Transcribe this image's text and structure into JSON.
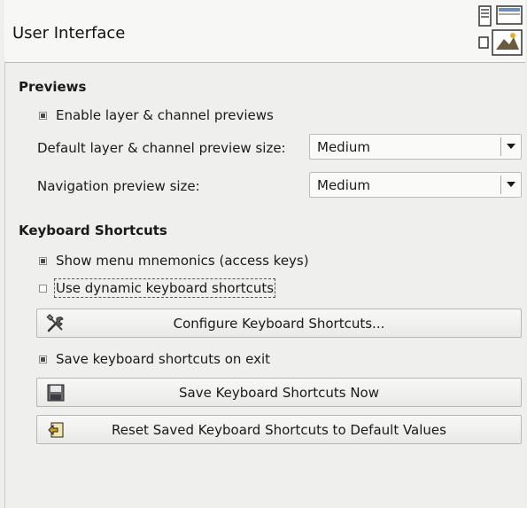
{
  "header": {
    "title": "User Interface",
    "icon": "preferences-window-icon"
  },
  "previews": {
    "section_title": "Previews",
    "enable_layer_previews": {
      "label": "Enable layer & channel previews",
      "checked": true
    },
    "default_preview_size": {
      "label": "Default layer & channel preview size:",
      "value": "Medium"
    },
    "navigation_preview_size": {
      "label": "Navigation preview size:",
      "value": "Medium"
    }
  },
  "keyboard": {
    "section_title": "Keyboard Shortcuts",
    "show_mnemonics": {
      "label": "Show menu mnemonics (access keys)",
      "checked": true
    },
    "dynamic_shortcuts": {
      "label": "Use dynamic keyboard shortcuts",
      "checked": false
    },
    "configure_button": {
      "label": "Configure Keyboard Shortcuts...",
      "icon": "tools-icon"
    },
    "save_on_exit": {
      "label": "Save keyboard shortcuts on exit",
      "checked": true
    },
    "save_now_button": {
      "label": "Save Keyboard Shortcuts Now",
      "icon": "floppy-disk-icon"
    },
    "reset_button": {
      "label": "Reset Saved Keyboard Shortcuts to Default Values",
      "icon": "reset-icon"
    }
  }
}
